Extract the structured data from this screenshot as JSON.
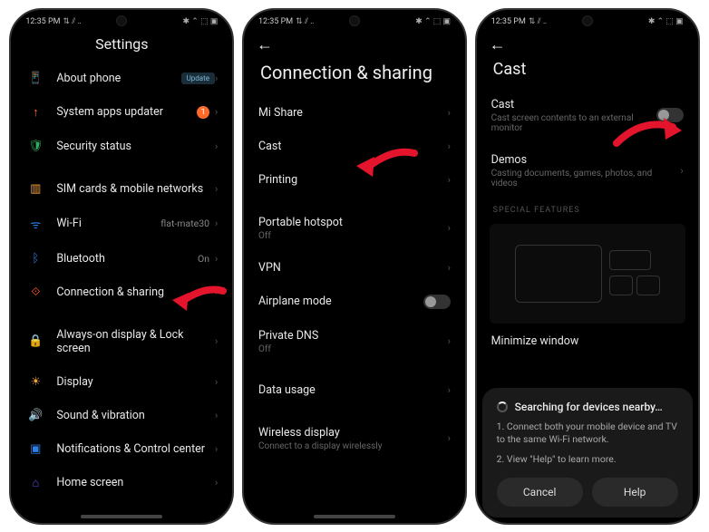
{
  "status": {
    "time": "12:35 PM",
    "indicators": "⇅ ⫽ ‥",
    "right_icons": "✱ ⌃ ⬚ ▣"
  },
  "p1": {
    "title": "Settings",
    "items": [
      {
        "icon": "📱",
        "icon_name": "phone-icon",
        "label": "About phone",
        "pill": "Update",
        "color": "#c0c0c0"
      },
      {
        "icon": "↑",
        "icon_name": "update-icon",
        "label": "System apps updater",
        "badge": "1",
        "color": "#ff6a2b"
      },
      {
        "icon": "🛡",
        "icon_name": "shield-icon",
        "label": "Security status",
        "color": "#2fae60"
      }
    ],
    "items2": [
      {
        "icon": "▥",
        "icon_name": "sim-icon",
        "label": "SIM cards & mobile networks",
        "color": "#f2a23a"
      },
      {
        "icon": "ᯤ",
        "icon_name": "wifi-icon",
        "label": "Wi-Fi",
        "val": "flat-mate30",
        "color": "#2f7de1"
      },
      {
        "icon": "ᛒ",
        "icon_name": "bluetooth-icon",
        "label": "Bluetooth",
        "val": "On",
        "color": "#2f7de1"
      },
      {
        "icon": "⟐",
        "icon_name": "connection-icon",
        "label": "Connection & sharing",
        "color": "#ff5a2b"
      }
    ],
    "items3": [
      {
        "icon": "🔒",
        "icon_name": "lock-icon",
        "label": "Always-on display & Lock screen",
        "color": "#e14a3a"
      },
      {
        "icon": "☀",
        "icon_name": "display-icon",
        "label": "Display",
        "color": "#f2a23a"
      },
      {
        "icon": "🔊",
        "icon_name": "sound-icon",
        "label": "Sound & vibration",
        "color": "#2fae60"
      },
      {
        "icon": "▣",
        "icon_name": "notifications-icon",
        "label": "Notifications & Control center",
        "color": "#2f7de1"
      },
      {
        "icon": "⌂",
        "icon_name": "home-icon",
        "label": "Home screen",
        "color": "#6a4ae1"
      }
    ]
  },
  "p2": {
    "title": "Connection & sharing",
    "g1": [
      {
        "label": "Mi Share"
      },
      {
        "label": "Cast"
      },
      {
        "label": "Printing"
      }
    ],
    "g2": [
      {
        "label": "Portable hotspot",
        "sub": "Off"
      },
      {
        "label": "VPN"
      },
      {
        "label": "Airplane mode",
        "toggle": true
      },
      {
        "label": "Private DNS",
        "sub": "Off"
      }
    ],
    "g3": [
      {
        "label": "Data usage"
      }
    ],
    "g4": [
      {
        "label": "Wireless display",
        "sub": "Connect to a display wirelessly"
      }
    ]
  },
  "p3": {
    "title": "Cast",
    "cast_label": "Cast",
    "cast_sub": "Cast screen contents to an external monitor",
    "demos_label": "Demos",
    "demos_sub": "Casting documents, games, photos, and videos",
    "section": "SPECIAL FEATURES",
    "minimize": "Minimize window",
    "sheet_title": "Searching for devices nearby…",
    "sheet_1": "1. Connect both your mobile device and TV to the same Wi-Fi network.",
    "sheet_2": "2. View \"Help\" to learn more.",
    "cancel": "Cancel",
    "help": "Help"
  },
  "arrow_color": "#e3142b"
}
